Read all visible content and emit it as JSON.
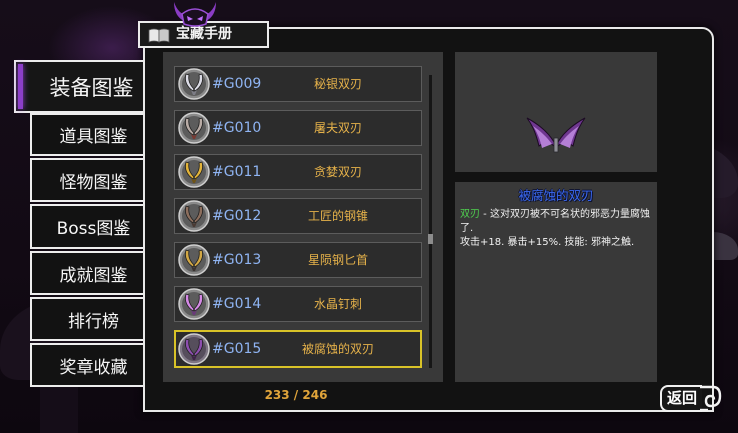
{
  "header": {
    "title": "宝藏手册",
    "title_icon": "book-icon",
    "emblem_icon": "demon-emblem-icon"
  },
  "sidebar": {
    "items": [
      {
        "label": "装备图鉴",
        "selected": true
      },
      {
        "label": "道具图鉴",
        "selected": false
      },
      {
        "label": "怪物图鉴",
        "selected": false
      },
      {
        "label": "Boss图鉴",
        "selected": false
      },
      {
        "label": "成就图鉴",
        "selected": false
      },
      {
        "label": "排行榜",
        "selected": false
      },
      {
        "label": "奖章收藏",
        "selected": false
      }
    ]
  },
  "list": {
    "items": [
      {
        "id": "#G009",
        "name": "秘银双刃",
        "icon": "crossed-blades-icon",
        "icon_color": "#dcdce6",
        "icon_accent": "#7d7d86"
      },
      {
        "id": "#G010",
        "name": "屠夫双刃",
        "icon": "crossed-blades-icon",
        "icon_color": "#b9aca6",
        "icon_accent": "#7a3a32"
      },
      {
        "id": "#G011",
        "name": "贪婪双刃",
        "icon": "crossed-blades-icon",
        "icon_color": "#e3b43a",
        "icon_accent": "#6e5418"
      },
      {
        "id": "#G012",
        "name": "工匠的钢锥",
        "icon": "crossed-blades-icon",
        "icon_color": "#8d6f5e",
        "icon_accent": "#4a3a33"
      },
      {
        "id": "#G013",
        "name": "星陨钢匕首",
        "icon": "crossed-blades-icon",
        "icon_color": "#d3a845",
        "icon_accent": "#3b3330"
      },
      {
        "id": "#G014",
        "name": "水晶钉刺",
        "icon": "crossed-blades-icon",
        "icon_color": "#d58ae6",
        "icon_accent": "#6a3a7a"
      },
      {
        "id": "#G015",
        "name": "被腐蚀的双刃",
        "icon": "crossed-blades-icon",
        "icon_color": "#8e4fb0",
        "icon_accent": "#3e2448"
      }
    ],
    "selected_index": 6,
    "counter": "233 / 246"
  },
  "detail": {
    "title": "被腐蚀的双刃",
    "icon": "corrupted-blades-icon",
    "icon_color": "#6f3790",
    "icon_highlight": "#b57fd6",
    "category": "双刃",
    "description": " - 这对双刃被不可名状的邪恶力量腐蚀了.",
    "stats": "攻击+18. 暴击+15%. 技能: 邪神之触."
  },
  "footer": {
    "back_label": "返回",
    "back_icon": "swirl-arrow-icon"
  },
  "colors": {
    "accent": "#8c3fc8",
    "id_text": "#8fb4f2",
    "name_text": "#e6b24a",
    "selected_border": "#d9c328",
    "counter_text": "#e0a43a",
    "detail_title": "#3a68f0",
    "category_text": "#4fd24f"
  }
}
